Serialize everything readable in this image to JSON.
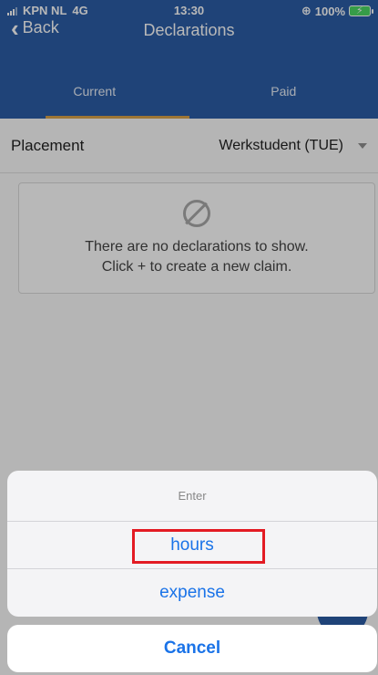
{
  "status": {
    "carrier": "KPN NL",
    "network": "4G",
    "time": "13:30",
    "battery": "100%"
  },
  "nav": {
    "back_label": "Back",
    "title": "Declarations"
  },
  "tabs": [
    {
      "label": "Current",
      "active": true
    },
    {
      "label": "Paid",
      "active": false
    }
  ],
  "placement": {
    "label": "Placement",
    "value": "Werkstudent (TUE)"
  },
  "empty_state": {
    "line1": "There are no declarations to show.",
    "line2": "Click + to create a new claim."
  },
  "action_sheet": {
    "title": "Enter",
    "options": [
      {
        "label": "hours",
        "highlighted": true
      },
      {
        "label": "expense",
        "highlighted": false
      }
    ],
    "cancel_label": "Cancel"
  },
  "colors": {
    "primary": "#2b5ea7",
    "accent": "#d8a24a",
    "link": "#1a73e8",
    "highlight": "#e31b23"
  }
}
